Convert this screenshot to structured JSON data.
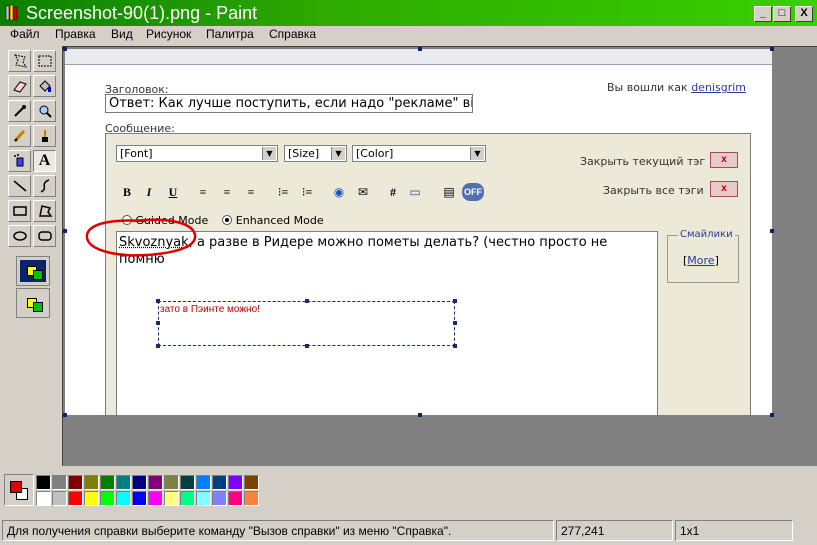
{
  "window": {
    "title": "Screenshot-90(1).png - Paint",
    "minimize_glyph": "_",
    "maximize_glyph": "□",
    "close_glyph": "X"
  },
  "menu": [
    "Файл",
    "Правка",
    "Вид",
    "Рисунок",
    "Палитра",
    "Справка"
  ],
  "page": {
    "subject_label": "Заголовок:",
    "subject_value": "Ответ: Как лучше поступить, если надо \"рекламе\" ві",
    "login_prefix": "Вы вошли как",
    "login_user": "denisgrim",
    "message_label": "Сообщение:",
    "font_select": "[Font]",
    "size_select": "[Size]",
    "color_select": "[Color]",
    "close_current_tag": "Закрыть текущий тэг",
    "close_all_tags": "Закрыть все тэги",
    "close_x": "x",
    "format_buttons": [
      "B",
      "I",
      "U",
      "≡",
      "≡",
      "≡",
      "⁝≡",
      "⁝≡",
      "◉",
      "✉",
      "#",
      "▭",
      "▤",
      "OFF"
    ],
    "guided_mode": "Guided Mode",
    "enhanced_mode": "Enhanced Mode",
    "message_username": "Skvoznyak",
    "message_text": ", а разве в Ридере можно пометы  делать? (честно просто не помню",
    "smilies_legend": "Смайлики",
    "smilies_more": "More",
    "annotation_text": "зато в Пэинте можно!"
  },
  "palette": {
    "foreground": "#e00000",
    "background": "#ffffff",
    "row1": [
      "#000000",
      "#808080",
      "#800000",
      "#808000",
      "#008000",
      "#008080",
      "#000080",
      "#800080",
      "#808040",
      "#004040",
      "#0080ff",
      "#004080",
      "#8000ff",
      "#804000"
    ],
    "row2": [
      "#ffffff",
      "#c0c0c0",
      "#ff0000",
      "#ffff00",
      "#00ff00",
      "#00ffff",
      "#0000ff",
      "#ff00ff",
      "#ffff80",
      "#00ff80",
      "#80ffff",
      "#8080ff",
      "#ff0080",
      "#ff8040"
    ]
  },
  "status": {
    "help": "Для получения справки выберите команду \"Вызов справки\" из меню \"Справка\".",
    "coords": "277,241",
    "size": "1x1"
  }
}
